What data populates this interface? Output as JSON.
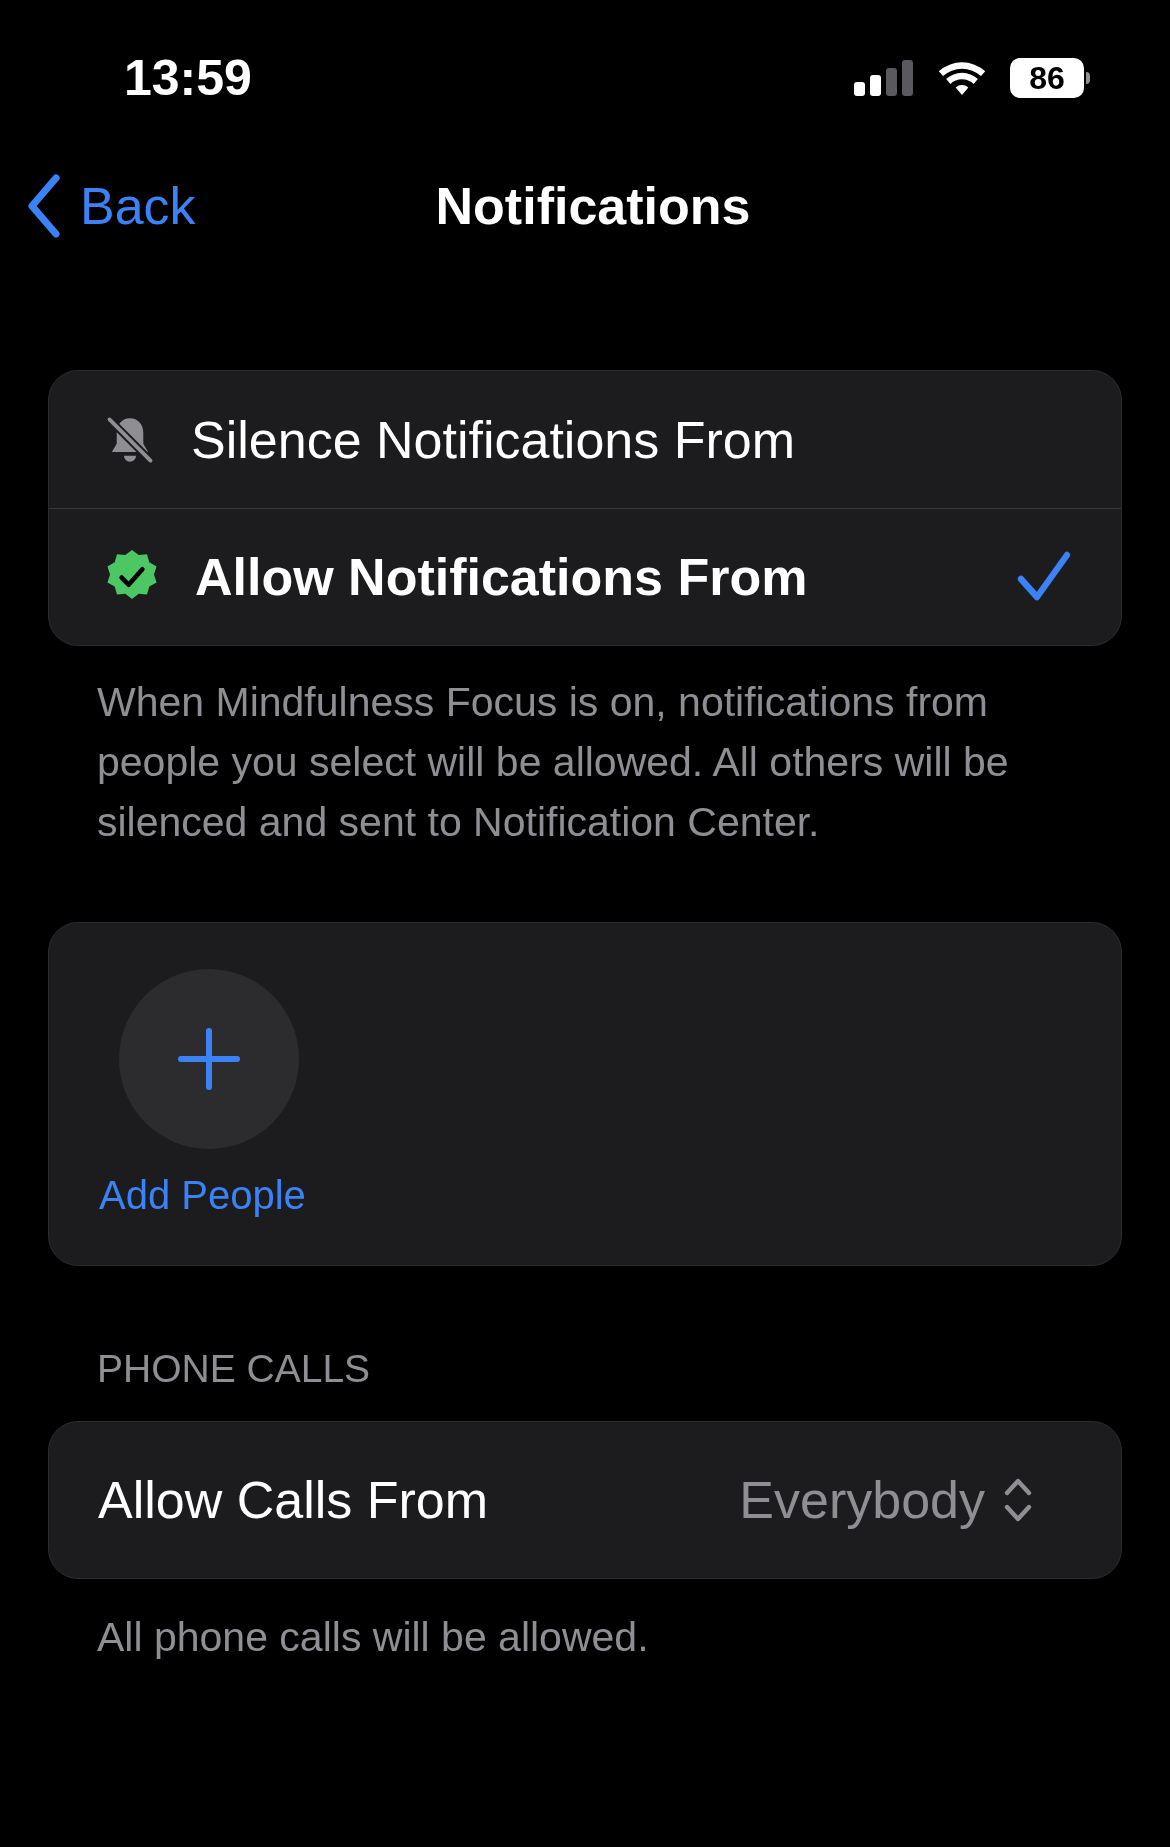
{
  "status_bar": {
    "time": "13:59",
    "battery": "86"
  },
  "nav": {
    "back": "Back",
    "title": "Notifications"
  },
  "mode_options": [
    {
      "kind": "silence",
      "label": "Silence Notifications From",
      "selected": false
    },
    {
      "kind": "allow",
      "label": "Allow Notifications From",
      "selected": true
    }
  ],
  "description": "When Mindfulness Focus is on, notifications from people you select will be allowed. All others will be silenced and sent to Notification Center.",
  "people": {
    "add_label": "Add People"
  },
  "phone_calls": {
    "header": "PHONE CALLS",
    "row": {
      "label": "Allow Calls From",
      "value": "Everybody"
    },
    "footer": "All phone calls will be allowed."
  }
}
